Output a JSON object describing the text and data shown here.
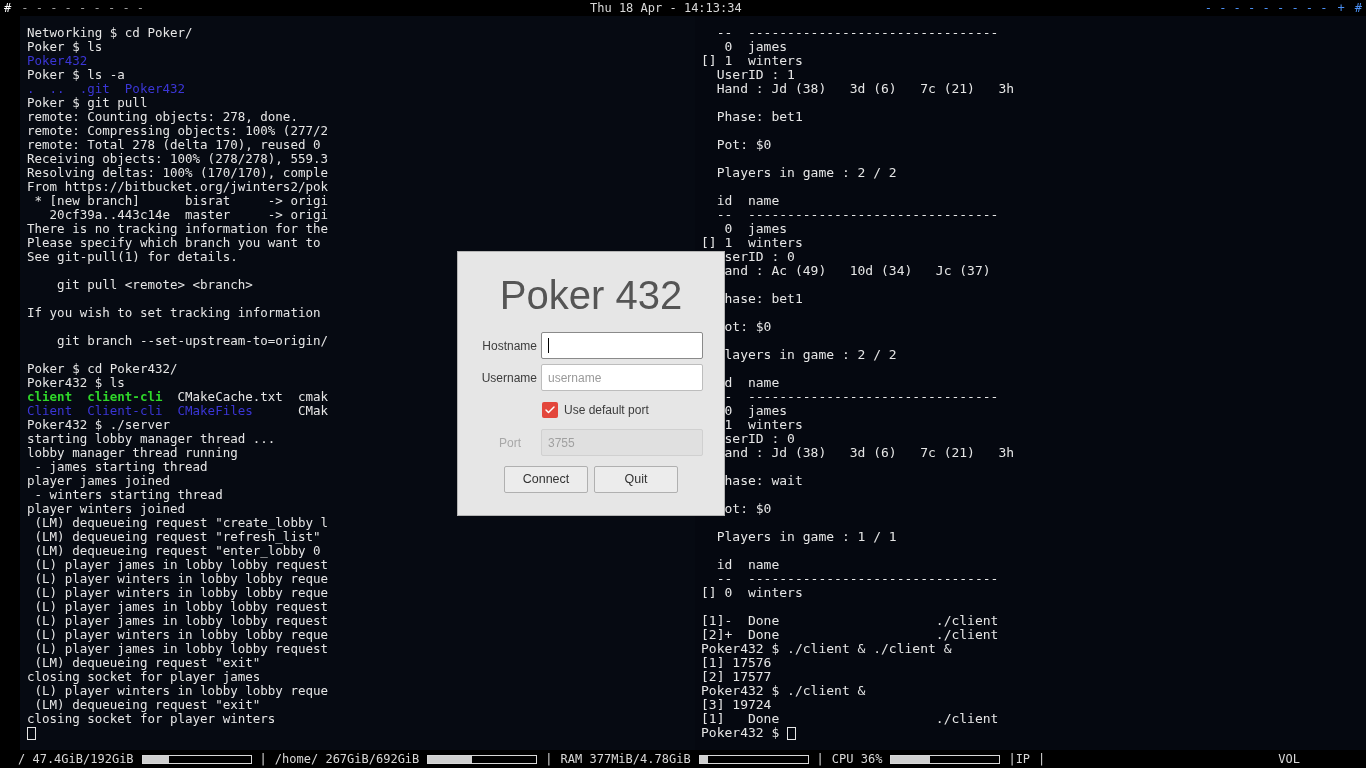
{
  "top_bar": {
    "left_mark": "#",
    "left_workspaces": "- - - - - - - - -",
    "clock": "Thu 18 Apr - 14:13:34",
    "right_workspaces": "- - - - - - - - -",
    "right_add": "+",
    "right_mark": "#"
  },
  "left_terminal": {
    "cursor": true,
    "lines": [
      "Networking $ cd Poker/",
      "Poker $ ls",
      {
        "spans": [
          {
            "text": "Poker432",
            "kind": "dir"
          }
        ]
      },
      "Poker $ ls -a",
      {
        "spans": [
          {
            "text": ".  ..  .git  Poker432",
            "kind": "dir"
          }
        ]
      },
      "Poker $ git pull",
      "remote: Counting objects: 278, done.",
      "remote: Compressing objects: 100% (277/2",
      "remote: Total 278 (delta 170), reused 0",
      "Receiving objects: 100% (278/278), 559.3",
      "Resolving deltas: 100% (170/170), comple",
      "From https://bitbucket.org/jwinters2/pok",
      " * [new branch]      bisrat     -> origi",
      "   20cf39a..443c14e  master     -> origi",
      "There is no tracking information for the",
      "Please specify which branch you want to",
      "See git-pull(1) for details.",
      {
        "kind": "blank"
      },
      "    git pull <remote> <branch>",
      {
        "kind": "blank"
      },
      "If you wish to set tracking information",
      {
        "kind": "blank"
      },
      "    git branch --set-upstream-to=origin/",
      {
        "kind": "blank"
      },
      "Poker $ cd Poker432/",
      "Poker432 $ ls",
      {
        "spans": [
          {
            "text": "client  client-cli",
            "kind": "exec"
          },
          {
            "text": "  CMakeCache.txt  cmak",
            "kind": "plain"
          }
        ]
      },
      {
        "spans": [
          {
            "text": "Client  Client-cli  CMakeFiles",
            "kind": "dir"
          },
          {
            "text": "      CMak",
            "kind": "plain"
          }
        ]
      },
      "Poker432 $ ./server",
      "starting lobby manager thread ...",
      "lobby manager thread running",
      " - james starting thread",
      "player james joined",
      " - winters starting thread",
      "player winters joined",
      " (LM) dequeueing request \"create_lobby l",
      " (LM) dequeueing request \"refresh_list\"",
      " (LM) dequeueing request \"enter_lobby 0",
      " (L) player james in lobby lobby request",
      " (L) player winters in lobby lobby reque",
      " (L) player winters in lobby lobby reque",
      " (L) player james in lobby lobby request",
      " (L) player james in lobby lobby request",
      " (L) player winters in lobby lobby reque",
      " (L) player james in lobby lobby request",
      " (LM) dequeueing request \"exit\"",
      "closing socket for player james",
      " (L) player winters in lobby lobby reque",
      " (LM) dequeueing request \"exit\"",
      "closing socket for player winters",
      {
        "kind": "blank"
      }
    ]
  },
  "right_terminal": {
    "cursor": true,
    "lines": [
      "  --  --------------------------------",
      "   0  james",
      "[] 1  winters",
      "  UserID : 1",
      "  Hand : Jd (38)   3d (6)   7c (21)   3h",
      {
        "kind": "blank"
      },
      "  Phase: bet1",
      {
        "kind": "blank"
      },
      "  Pot: $0",
      {
        "kind": "blank"
      },
      "  Players in game : 2 / 2",
      {
        "kind": "blank"
      },
      "  id  name",
      "  --  --------------------------------",
      "   0  james",
      "[] 1  winters",
      "   serID : 0",
      "   and : Ac (49)   10d (34)   Jc (37)",
      {
        "kind": "blank"
      },
      "   hase: bet1",
      {
        "kind": "blank"
      },
      "   ot: $0",
      {
        "kind": "blank"
      },
      "   layers in game : 2 / 2",
      {
        "kind": "blank"
      },
      "   d  name",
      "   -  --------------------------------",
      "   0  james",
      "   1  winters",
      "   serID : 0",
      "   and : Jd (38)   3d (6)   7c (21)   3h",
      {
        "kind": "blank"
      },
      "   hase: wait",
      {
        "kind": "blank"
      },
      "   ot: $0",
      {
        "kind": "blank"
      },
      "  Players in game : 1 / 1",
      {
        "kind": "blank"
      },
      "  id  name",
      "  --  --------------------------------",
      "[] 0  winters",
      {
        "kind": "blank"
      },
      "[1]-  Done                    ./client",
      "[2]+  Done                    ./client",
      "Poker432 $ ./client & ./client &",
      "[1] 17576",
      "[2] 17577",
      "Poker432 $ ./client &",
      "[3] 19724",
      "[1]   Done                    ./client",
      "Poker432 $ "
    ]
  },
  "dialog": {
    "title": "Poker 432",
    "fields": [
      {
        "label": "Hostname",
        "focused": true,
        "disabled": false
      },
      {
        "label": "Username",
        "placeholder": "username",
        "focused": false,
        "disabled": false
      }
    ],
    "checkbox": {
      "label": "Use default port",
      "checked": true
    },
    "port": {
      "label": "Port",
      "value": "3755",
      "disabled": true
    },
    "buttons": [
      "Connect",
      "Quit"
    ]
  },
  "status_bar": [
    {
      "kind": "meter",
      "label": "/ 47.4GiB/192GiB",
      "level": 0.24
    },
    {
      "kind": "text",
      "label": "|"
    },
    {
      "kind": "meter",
      "label": "/home/ 267GiB/692GiB",
      "level": 0.4
    },
    {
      "kind": "text",
      "label": "|"
    },
    {
      "kind": "meter",
      "label": "RAM 377MiB/4.78GiB",
      "level": 0.08
    },
    {
      "kind": "text",
      "label": "|"
    },
    {
      "kind": "meter",
      "label": "CPU 36%",
      "level": 0.36
    },
    {
      "kind": "text",
      "label": "|IP"
    },
    {
      "kind": "text",
      "label": "|"
    },
    {
      "kind": "spacer"
    },
    {
      "kind": "text",
      "label": "VOL"
    }
  ]
}
